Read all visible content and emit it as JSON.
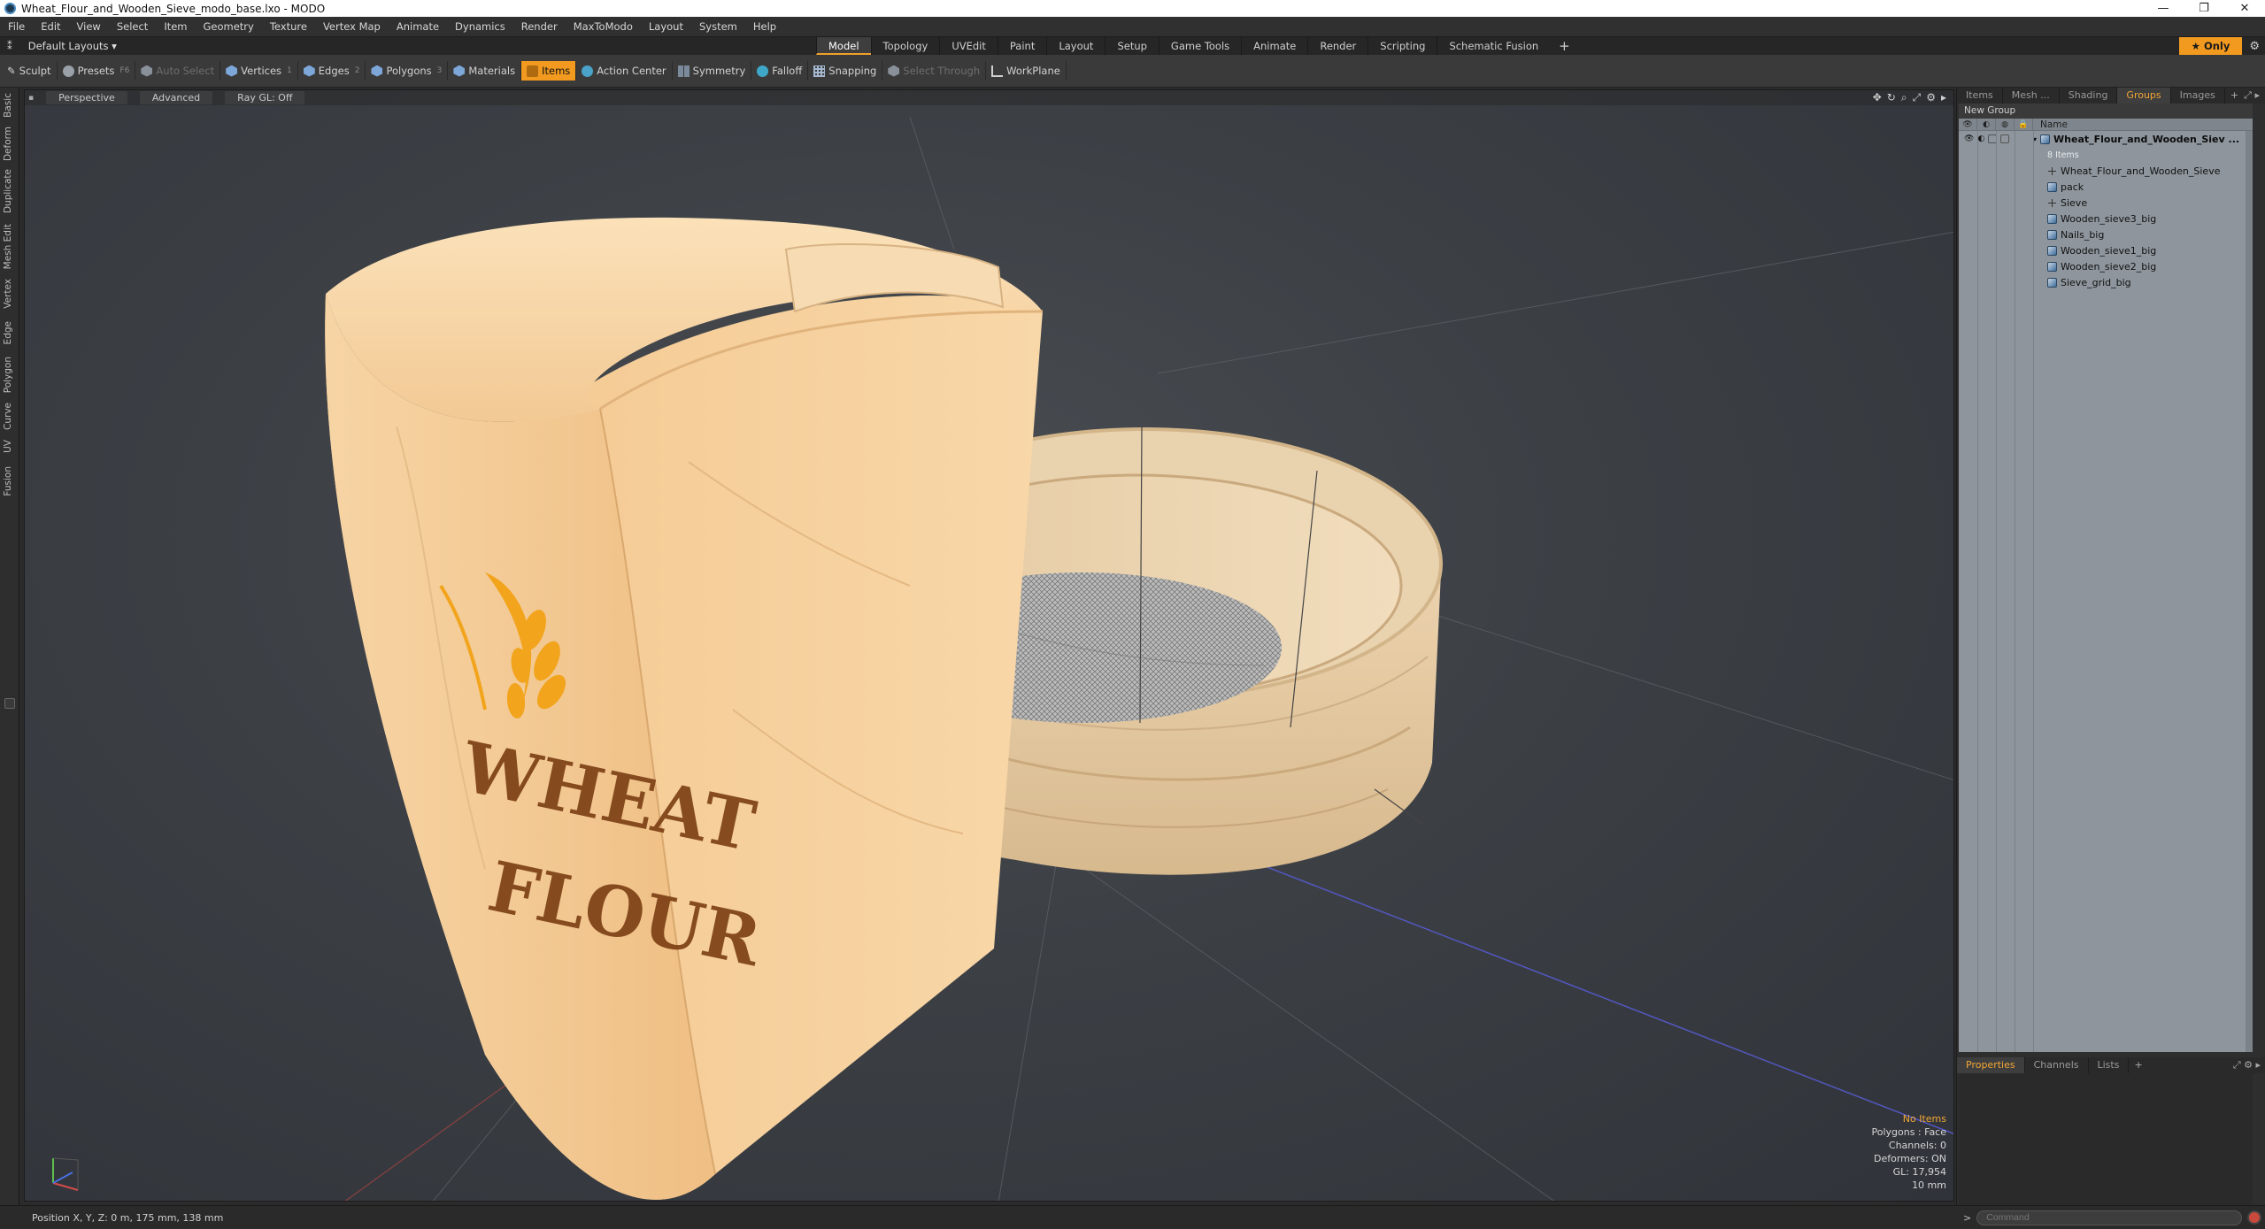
{
  "window": {
    "title": "Wheat_Flour_and_Wooden_Sieve_modo_base.lxo - MODO",
    "controls": [
      "—",
      "❐",
      "✕"
    ]
  },
  "menu": [
    "File",
    "Edit",
    "View",
    "Select",
    "Item",
    "Geometry",
    "Texture",
    "Vertex Map",
    "Animate",
    "Dynamics",
    "Render",
    "MaxToModo",
    "Layout",
    "System",
    "Help"
  ],
  "layout_bar": {
    "layout_select": "Default Layouts ▾",
    "tabs": [
      "Model",
      "Topology",
      "UVEdit",
      "Paint",
      "Layout",
      "Setup",
      "Game Tools",
      "Animate",
      "Render",
      "Scripting",
      "Schematic Fusion"
    ],
    "active_tab": "Model",
    "only_label": "★ Only"
  },
  "toolbar": {
    "sculpt": "Sculpt",
    "presets": "Presets",
    "presets_key": "F6",
    "auto_select": "Auto Select",
    "vertices": "Vertices",
    "vertices_num": "1",
    "edges": "Edges",
    "edges_num": "2",
    "polygons": "Polygons",
    "polygons_num": "3",
    "materials": "Materials",
    "items": "Items",
    "action_center": "Action Center",
    "symmetry": "Symmetry",
    "falloff": "Falloff",
    "snapping": "Snapping",
    "select_through": "Select Through",
    "workplane": "WorkPlane"
  },
  "left_tabs": [
    "Basic",
    "Deform",
    "Duplicate",
    "Mesh Edit",
    "Vertex",
    "Edge",
    "Polygon",
    "Curve",
    "UV",
    "Fusion"
  ],
  "viewport": {
    "view_mode": "Perspective",
    "shading": "Advanced",
    "raygl": "Ray GL: Off",
    "hud": {
      "title": "No Items",
      "polygons": "Polygons : Face",
      "channels": "Channels: 0",
      "deformers": "Deformers: ON",
      "gl": "GL: 17,954",
      "scale": "10 mm"
    },
    "bag_print_lines": [
      "WHEAT",
      "FLOUR"
    ]
  },
  "status": {
    "position": "Position X, Y, Z:  0 m, 175 mm, 138 mm"
  },
  "right_panel": {
    "tabs": [
      "Items",
      "Mesh ...",
      "Shading",
      "Groups",
      "Images"
    ],
    "active_tab": "Groups",
    "new_group": "New Group",
    "name_header": "Name",
    "root": "Wheat_Flour_and_Wooden_Siev ...",
    "root_sub": "8 Items",
    "items": [
      {
        "label": "Wheat_Flour_and_Wooden_Sieve",
        "icon": "locator-icon"
      },
      {
        "label": "pack",
        "icon": "mesh-icon"
      },
      {
        "label": "Sieve",
        "icon": "locator-icon"
      },
      {
        "label": "Wooden_sieve3_big",
        "icon": "mesh-icon"
      },
      {
        "label": "Nails_big",
        "icon": "mesh-icon"
      },
      {
        "label": "Wooden_sieve1_big",
        "icon": "mesh-icon"
      },
      {
        "label": "Wooden_sieve2_big",
        "icon": "mesh-icon"
      },
      {
        "label": "Sieve_grid_big",
        "icon": "mesh-icon"
      }
    ],
    "bottom_tabs": [
      "Properties",
      "Channels",
      "Lists"
    ],
    "bottom_active": "Properties",
    "command_placeholder": "Command"
  },
  "colors": {
    "accent": "#f29a1f",
    "bag": "#f2c58c",
    "wood": "#ead2ae",
    "logo": "#f2a41c",
    "print": "#7a3d12"
  }
}
